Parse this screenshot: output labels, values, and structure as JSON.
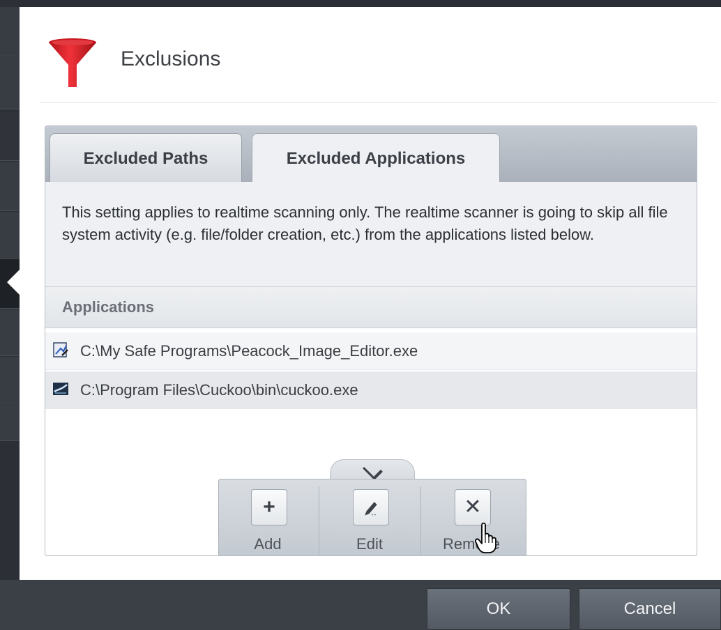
{
  "dialog": {
    "title": "Exclusions",
    "title_icon": "funnel-icon"
  },
  "tabs": [
    {
      "label": "Excluded Paths",
      "active": false
    },
    {
      "label": "Excluded Applications",
      "active": true
    }
  ],
  "info": {
    "text": "This setting applies to realtime scanning only. The realtime scanner is going to skip all file system activity (e.g. file/folder creation, etc.) from the applications listed below."
  },
  "table": {
    "column_header": "Applications",
    "rows": [
      {
        "icon": "image-editor-app-icon",
        "path": "C:\\My Safe Programs\\Peacock_Image_Editor.exe"
      },
      {
        "icon": "cuckoo-app-icon",
        "path": "C:\\Program Files\\Cuckoo\\bin\\cuckoo.exe"
      }
    ]
  },
  "toolbar": {
    "add_label": "Add",
    "edit_label": "Edit",
    "remove_label": "Remove"
  },
  "footer": {
    "ok_label": "OK",
    "cancel_label": "Cancel"
  }
}
